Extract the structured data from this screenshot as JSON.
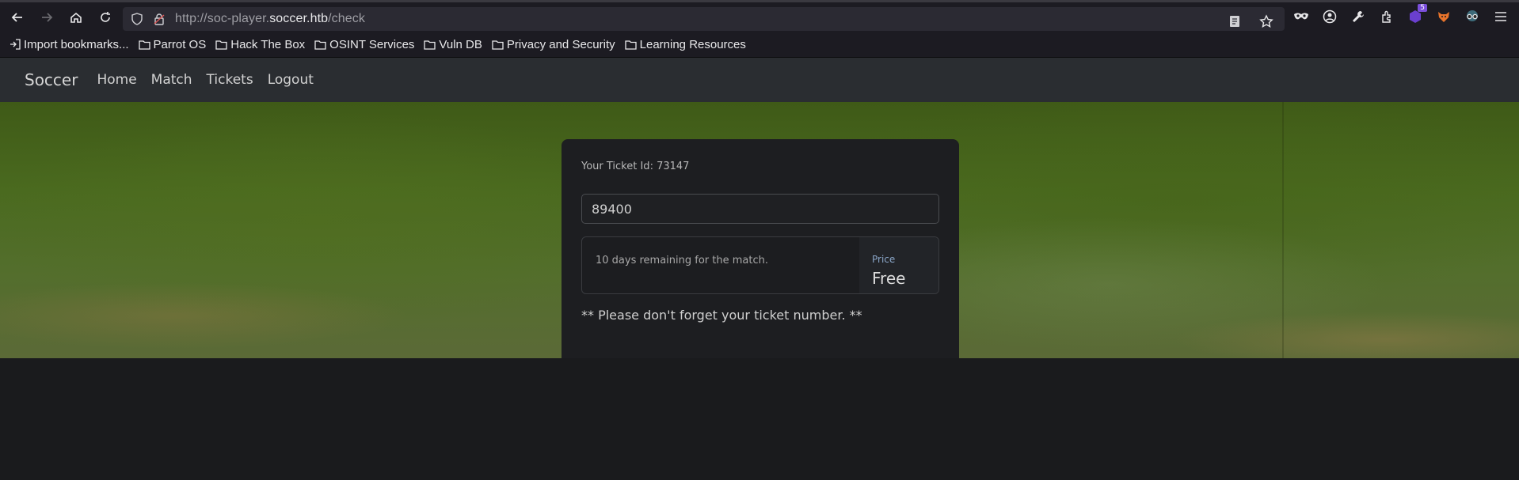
{
  "browser": {
    "url_prefix": "http://soc-player.",
    "url_host": "soccer.htb",
    "url_path": "/check",
    "extension_badge": "5"
  },
  "bookmarks": [
    {
      "label": "Import bookmarks..."
    },
    {
      "label": "Parrot OS"
    },
    {
      "label": "Hack The Box"
    },
    {
      "label": "OSINT Services"
    },
    {
      "label": "Vuln DB"
    },
    {
      "label": "Privacy and Security"
    },
    {
      "label": "Learning Resources"
    }
  ],
  "site_nav": {
    "brand": "Soccer",
    "links": [
      "Home",
      "Match",
      "Tickets",
      "Logout"
    ]
  },
  "card": {
    "ticket_id_text": "Your Ticket Id: 73147",
    "input_value": "89400",
    "remaining_text": "10 days remaining for the match.",
    "price_label": "Price",
    "price_value": "Free",
    "note": "** Please don't forget your ticket number. **"
  },
  "colors": {
    "page_bg": "#1a1b1d",
    "nav_bg": "#2a2d31",
    "card_bg": "#1d1e21",
    "price_label": "#8aa6c8"
  }
}
